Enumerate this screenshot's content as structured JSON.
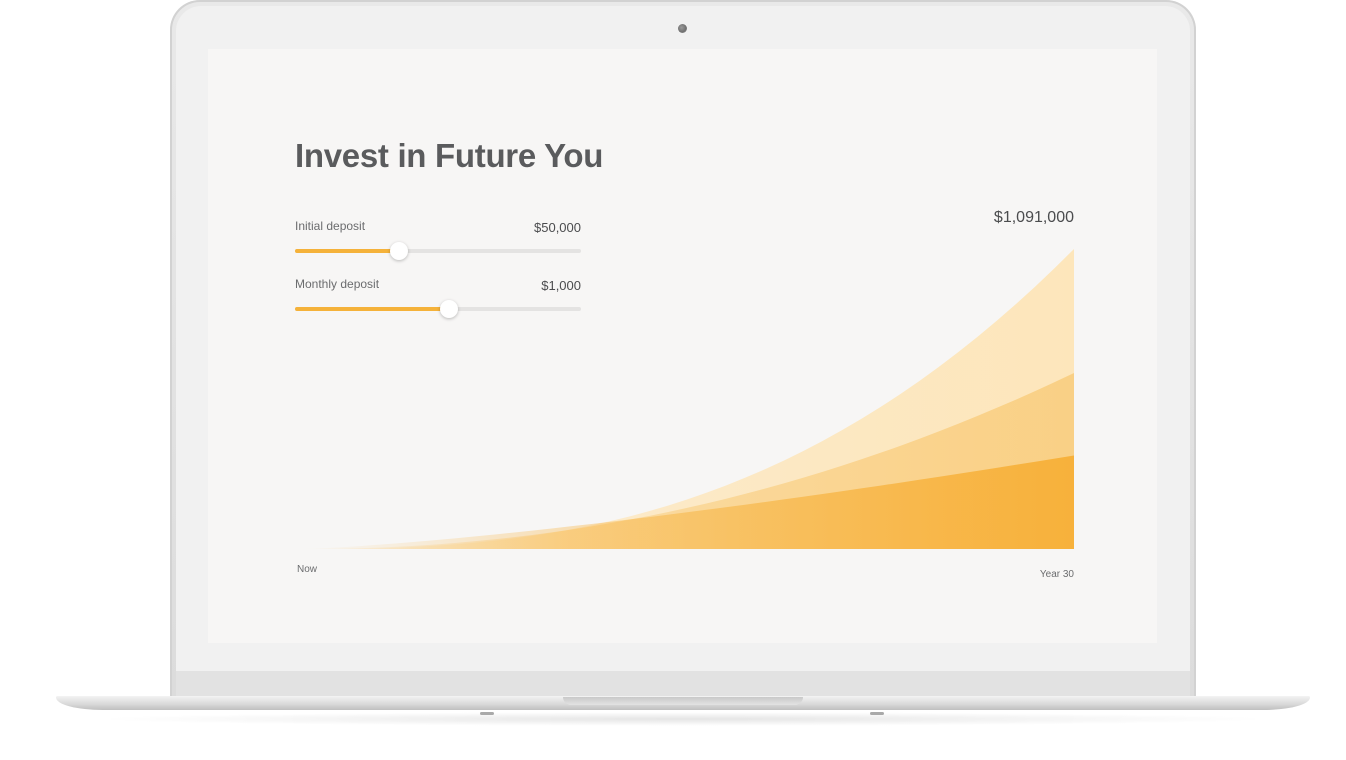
{
  "app": {
    "title": "Invest in Future You"
  },
  "sliders": [
    {
      "label": "Initial deposit",
      "value_text": "$50,000",
      "fraction": 0.365
    },
    {
      "label": "Monthly deposit",
      "value_text": "$1,000",
      "fraction": 0.54
    }
  ],
  "chart_data": {
    "type": "area",
    "title": "",
    "total_label": "$1,091,000",
    "x_start_label": "Now",
    "x_end_label": "Year 30",
    "series": [
      {
        "values": [
          0,
          1091000
        ]
      },
      {
        "values": [
          0,
          640000
        ]
      },
      {
        "values": [
          0,
          340000
        ]
      }
    ],
    "ylim": [
      0,
      1091000
    ],
    "colors": {
      "accent": "#f5b23a",
      "layer_top": "#fde6bb",
      "layer_mid": "#f9cf83",
      "layer_base": "#f7b13b"
    }
  },
  "colors": {
    "screen_bg": "#f7f6f5",
    "title": "#5a5b5d",
    "text": "#4b4c4e",
    "track": "#e4e3e2"
  }
}
